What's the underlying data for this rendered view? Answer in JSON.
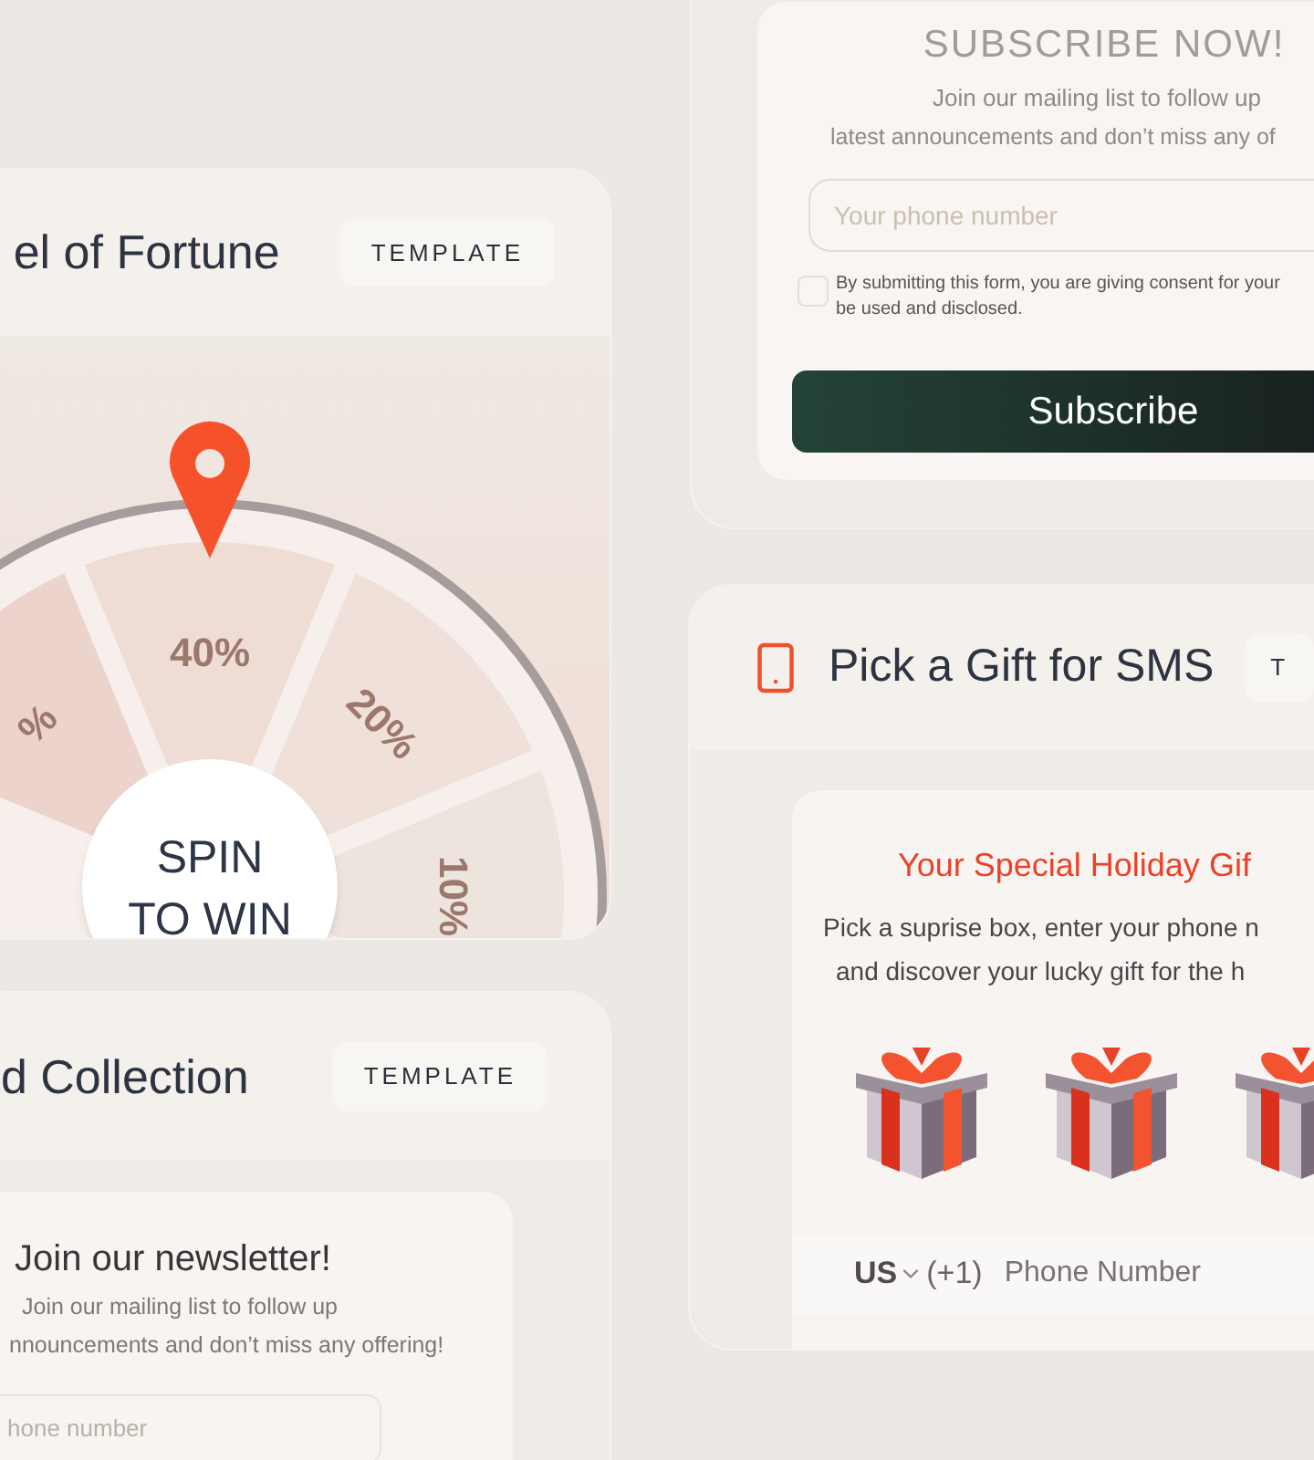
{
  "subscribe_card": {
    "title": "SUBSCRIBE NOW!",
    "description_lines": [
      "Join our mailing list to follow up",
      "latest announcements and don’t miss any of"
    ],
    "phone_placeholder": "Your phone number",
    "consent": {
      "checked": false,
      "text_lines": [
        "By submitting this form, you are giving consent for your",
        "be used and disclosed."
      ]
    },
    "button": "Subscribe"
  },
  "wheel_card": {
    "title": "el of Fortune",
    "badge": "TEMPLATE",
    "wheel": {
      "segments": [
        {
          "label": "%"
        },
        {
          "label": "40%"
        },
        {
          "label": "20%"
        },
        {
          "label": "10%"
        }
      ],
      "center_lines": [
        "SPIN",
        "TO WIN"
      ]
    }
  },
  "collection_card": {
    "title": "d Collection",
    "badge": "TEMPLATE",
    "newsletter": {
      "title": "Join our newsletter!",
      "description_lines": [
        "Join our mailing list to follow up",
        "nnouncements and  don’t miss any offering!"
      ],
      "phone_placeholder": "hone number"
    }
  },
  "gift_card": {
    "title": "Pick a Gift for SMS",
    "badge": "T",
    "form": {
      "title": "Your Special Holiday Gif",
      "description_lines": [
        "Pick a suprise box, enter your phone n",
        "and discover your lucky gift for the h"
      ],
      "phone": {
        "country": "US",
        "code": "(+1)",
        "placeholder": "Phone Number"
      }
    }
  }
}
